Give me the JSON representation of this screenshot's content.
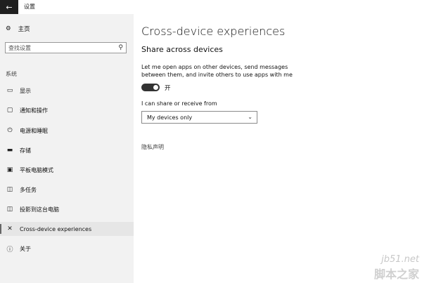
{
  "window": {
    "title": "设置"
  },
  "sidebar": {
    "home_label": "主页",
    "search_placeholder": "查找设置",
    "section_label": "系统",
    "items": [
      {
        "label": "显示",
        "icon": "display-icon"
      },
      {
        "label": "通知和操作",
        "icon": "notifications-icon"
      },
      {
        "label": "电源和睡眠",
        "icon": "power-icon"
      },
      {
        "label": "存储",
        "icon": "storage-icon"
      },
      {
        "label": "平板电脑模式",
        "icon": "tablet-mode-icon"
      },
      {
        "label": "多任务",
        "icon": "multitasking-icon"
      },
      {
        "label": "投影到这台电脑",
        "icon": "projecting-icon"
      },
      {
        "label": "Cross-device experiences",
        "icon": "cross-device-icon"
      },
      {
        "label": "关于",
        "icon": "info-icon"
      }
    ],
    "selected_index": 7
  },
  "main": {
    "page_title": "Cross-device experiences",
    "section_title": "Share across devices",
    "description": "Let me open apps on other devices, send messages between them, and invite others to use apps with me",
    "toggle": {
      "state": "on",
      "label": "开"
    },
    "share_label": "I can share or receive from",
    "dropdown": {
      "selected": "My devices only"
    },
    "privacy_link": "隐私声明"
  },
  "watermark": {
    "line1": "jb51.net",
    "line2": "脚本之家"
  }
}
